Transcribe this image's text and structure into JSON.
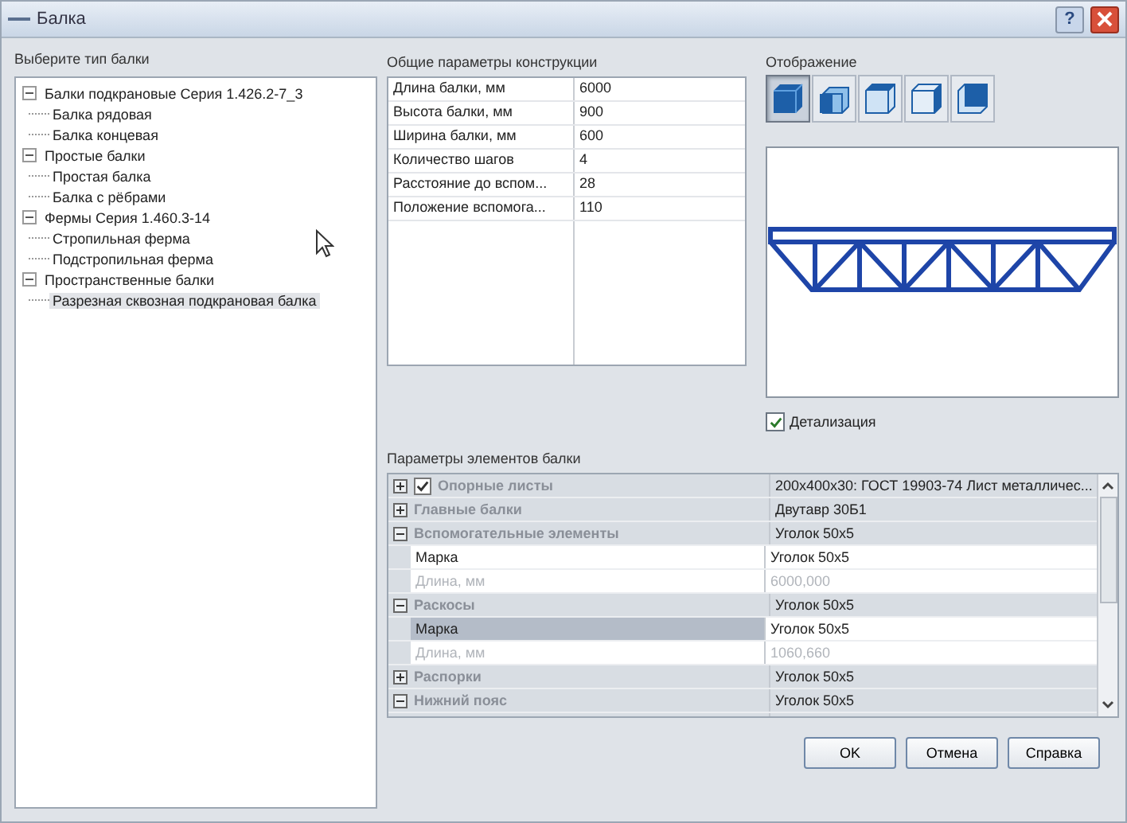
{
  "window": {
    "title": "Балка",
    "help": "?"
  },
  "beam_type": {
    "label": "Выберите тип балки",
    "tree": [
      {
        "label": "Балки подкрановые Серия 1.426.2-7_3",
        "expanded": true,
        "selected": false,
        "children": [
          {
            "label": "Балка рядовая",
            "selected": false
          },
          {
            "label": "Балка концевая",
            "selected": false
          }
        ]
      },
      {
        "label": "Простые балки",
        "expanded": true,
        "selected": false,
        "children": [
          {
            "label": "Простая балка",
            "selected": false
          },
          {
            "label": "Балка с рёбрами",
            "selected": false
          }
        ]
      },
      {
        "label": "Фермы Серия 1.460.3-14",
        "expanded": true,
        "selected": false,
        "children": [
          {
            "label": "Стропильная ферма",
            "selected": false
          },
          {
            "label": "Подстропильная ферма",
            "selected": false
          }
        ]
      },
      {
        "label": "Пространственные балки",
        "expanded": true,
        "selected": false,
        "children": [
          {
            "label": "Разрезная сквозная подкрановая балка",
            "selected": true
          }
        ]
      }
    ]
  },
  "general_params": {
    "label": "Общие параметры конструкции",
    "rows": [
      {
        "name": "Длина балки, мм",
        "value": "6000"
      },
      {
        "name": "Высота балки, мм",
        "value": "900"
      },
      {
        "name": "Ширина балки, мм",
        "value": "600"
      },
      {
        "name": "Количество шагов",
        "value": "4"
      },
      {
        "name": "Расстояние до вспом...",
        "value": "28"
      },
      {
        "name": "Положение вспомога...",
        "value": "110"
      }
    ]
  },
  "display": {
    "label": "Отображение",
    "views": [
      {
        "selected": true
      },
      {
        "selected": false
      },
      {
        "selected": false
      },
      {
        "selected": false
      },
      {
        "selected": false
      }
    ],
    "detail": {
      "label": "Детализация",
      "checked": true
    }
  },
  "element_params": {
    "label": "Параметры элементов балки",
    "rows": [
      {
        "kind": "category",
        "name": "Опорные листы",
        "expanded": false,
        "has_checkbox": true,
        "checked": true,
        "value": "200x400x30: ГОСТ 19903-74 Лист металличес..."
      },
      {
        "kind": "category",
        "name": "Главные балки",
        "expanded": false,
        "value": "Двутавр 30Б1"
      },
      {
        "kind": "category",
        "name": "Вспомогательные элементы",
        "expanded": true,
        "value": "Уголок 50x5"
      },
      {
        "kind": "property",
        "name": "Марка",
        "value": "Уголок 50x5",
        "selected": false,
        "disabled": false
      },
      {
        "kind": "property",
        "name": "Длина, мм",
        "value": "6000,000",
        "selected": false,
        "disabled": true
      },
      {
        "kind": "category",
        "name": "Раскосы",
        "expanded": true,
        "value": "Уголок 50x5"
      },
      {
        "kind": "property",
        "name": "Марка",
        "value": "Уголок 50x5",
        "selected": true,
        "disabled": false
      },
      {
        "kind": "property",
        "name": "Длина, мм",
        "value": "1060,660",
        "selected": false,
        "disabled": true
      },
      {
        "kind": "category",
        "name": "Распорки",
        "expanded": false,
        "value": "Уголок 50x5"
      },
      {
        "kind": "category",
        "name": "Нижний пояс",
        "expanded": true,
        "value": "Уголок 50x5"
      }
    ]
  },
  "buttons": [
    "OK",
    "Отмена",
    "Справка"
  ]
}
